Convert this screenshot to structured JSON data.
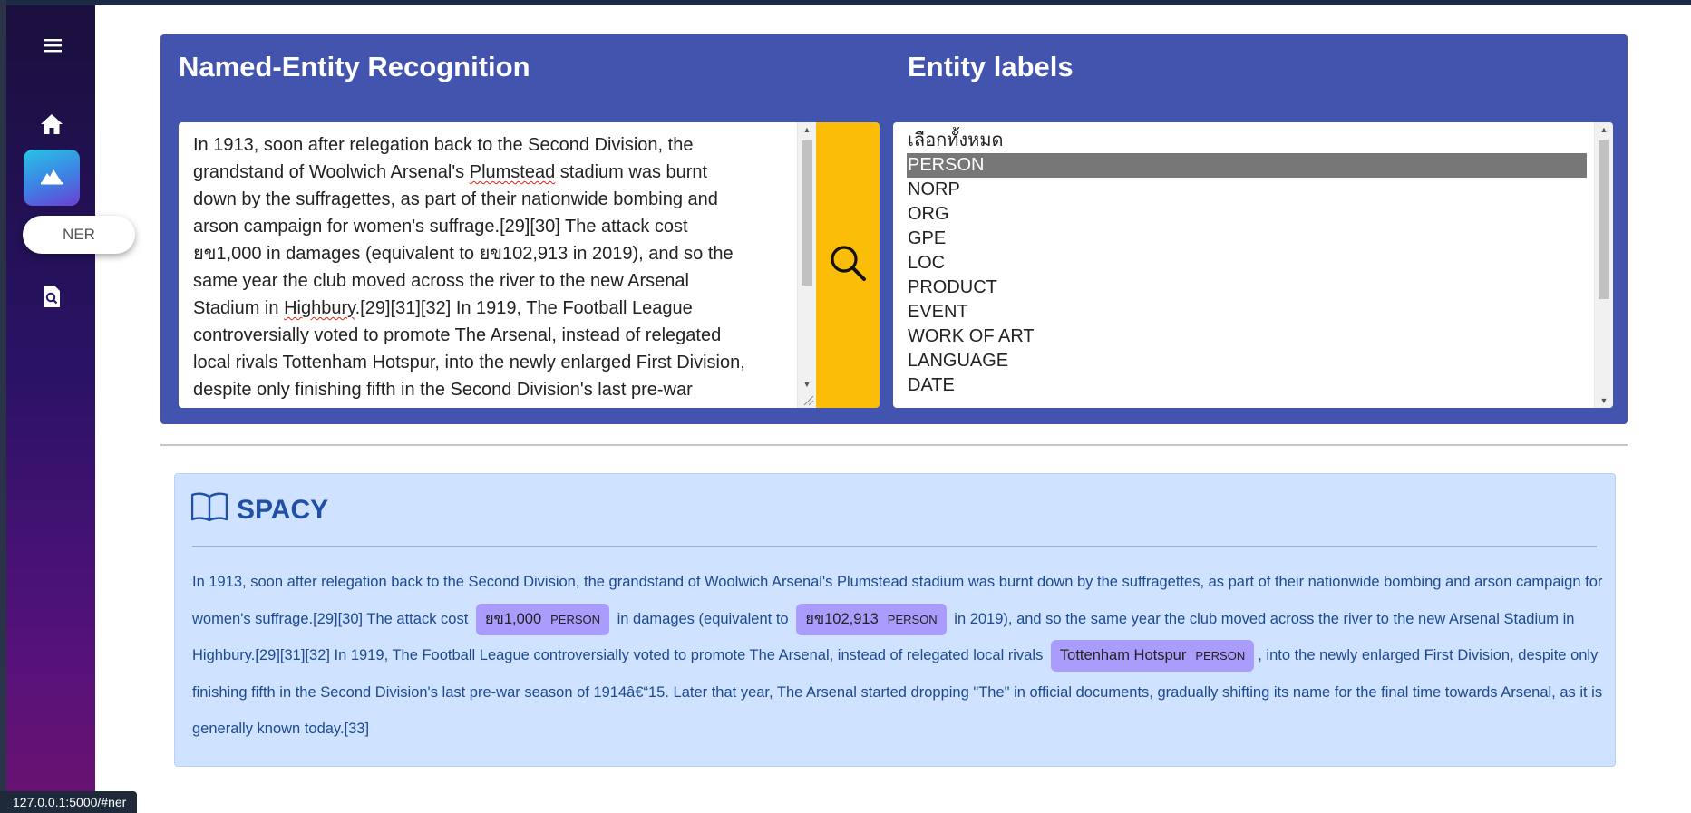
{
  "sidebar": {
    "tooltip": "NER",
    "icons": [
      "menu-icon",
      "home-icon",
      "ner-icon",
      "search-document-icon"
    ]
  },
  "status_bar": {
    "url": "127.0.0.1:5000/#ner"
  },
  "ner_panel": {
    "title": "Named-Entity Recognition",
    "labels_title": "Entity labels",
    "input_text_lines": [
      "In 1913, soon after relegation back to the Second Division, the",
      "grandstand of Woolwich Arsenal's ",
      "Plumstead",
      " stadium was burnt",
      "down by the suffragettes, as part of their nationwide bombing and",
      "arson campaign for women's suffrage.[29][30] The attack cost",
      "ยข1,000 in damages (equivalent to ยข102,913 in 2019), and so the",
      "same year the club moved across the river to the new Arsenal",
      "Stadium in ",
      "Highbury",
      ".[29][31][32] In 1919, The Football League",
      "controversially voted to promote The Arsenal, instead of relegated",
      "local rivals Tottenham Hotspur, into the newly enlarged First Division,",
      "despite only finishing fifth in the Second Division's last pre-war"
    ],
    "search_button_icon": "search-icon",
    "entity_labels": [
      "เลือกทั้งหมด",
      "PERSON",
      "NORP",
      "ORG",
      "GPE",
      "LOC",
      "PRODUCT",
      "EVENT",
      "WORK OF ART",
      "LANGUAGE",
      "DATE"
    ],
    "selected_label": "PERSON"
  },
  "result": {
    "title": "SPACY",
    "icon": "book-icon",
    "segments": [
      "In 1913, soon after relegation back to the Second Division, the grandstand of Woolwich Arsenal's Plumstead stadium was burnt down by the suffragettes, as part of their nationwide bombing and arson campaign for women's suffrage.[29][30] The attack cost",
      " in damages (equivalent to",
      " in 2019), and so the same year the club moved across the river to the new Arsenal Stadium in Highbury.[29][31][32] In 1919, The Football League controversially voted to promote The Arsenal, instead of relegated local rivals",
      ", into the newly enlarged First Division, despite only finishing fifth in the Second Division's last pre-war season of 1914â€“15. Later that year, The Arsenal started dropping \"The\" in official documents, gradually shifting its name for the final time towards Arsenal, as it is generally known today.[33]"
    ],
    "entities": [
      {
        "text": "ยข1,000",
        "label": "PERSON"
      },
      {
        "text": "ยข102,913",
        "label": "PERSON"
      },
      {
        "text": "Tottenham Hotspur",
        "label": "PERSON"
      }
    ]
  },
  "colors": {
    "panel_bg": "#4254ae",
    "search_button": "#fbbd07",
    "result_bg": "#cfe2ff",
    "entity_highlight": "#aa9cfc",
    "selected_option": "#777777"
  }
}
